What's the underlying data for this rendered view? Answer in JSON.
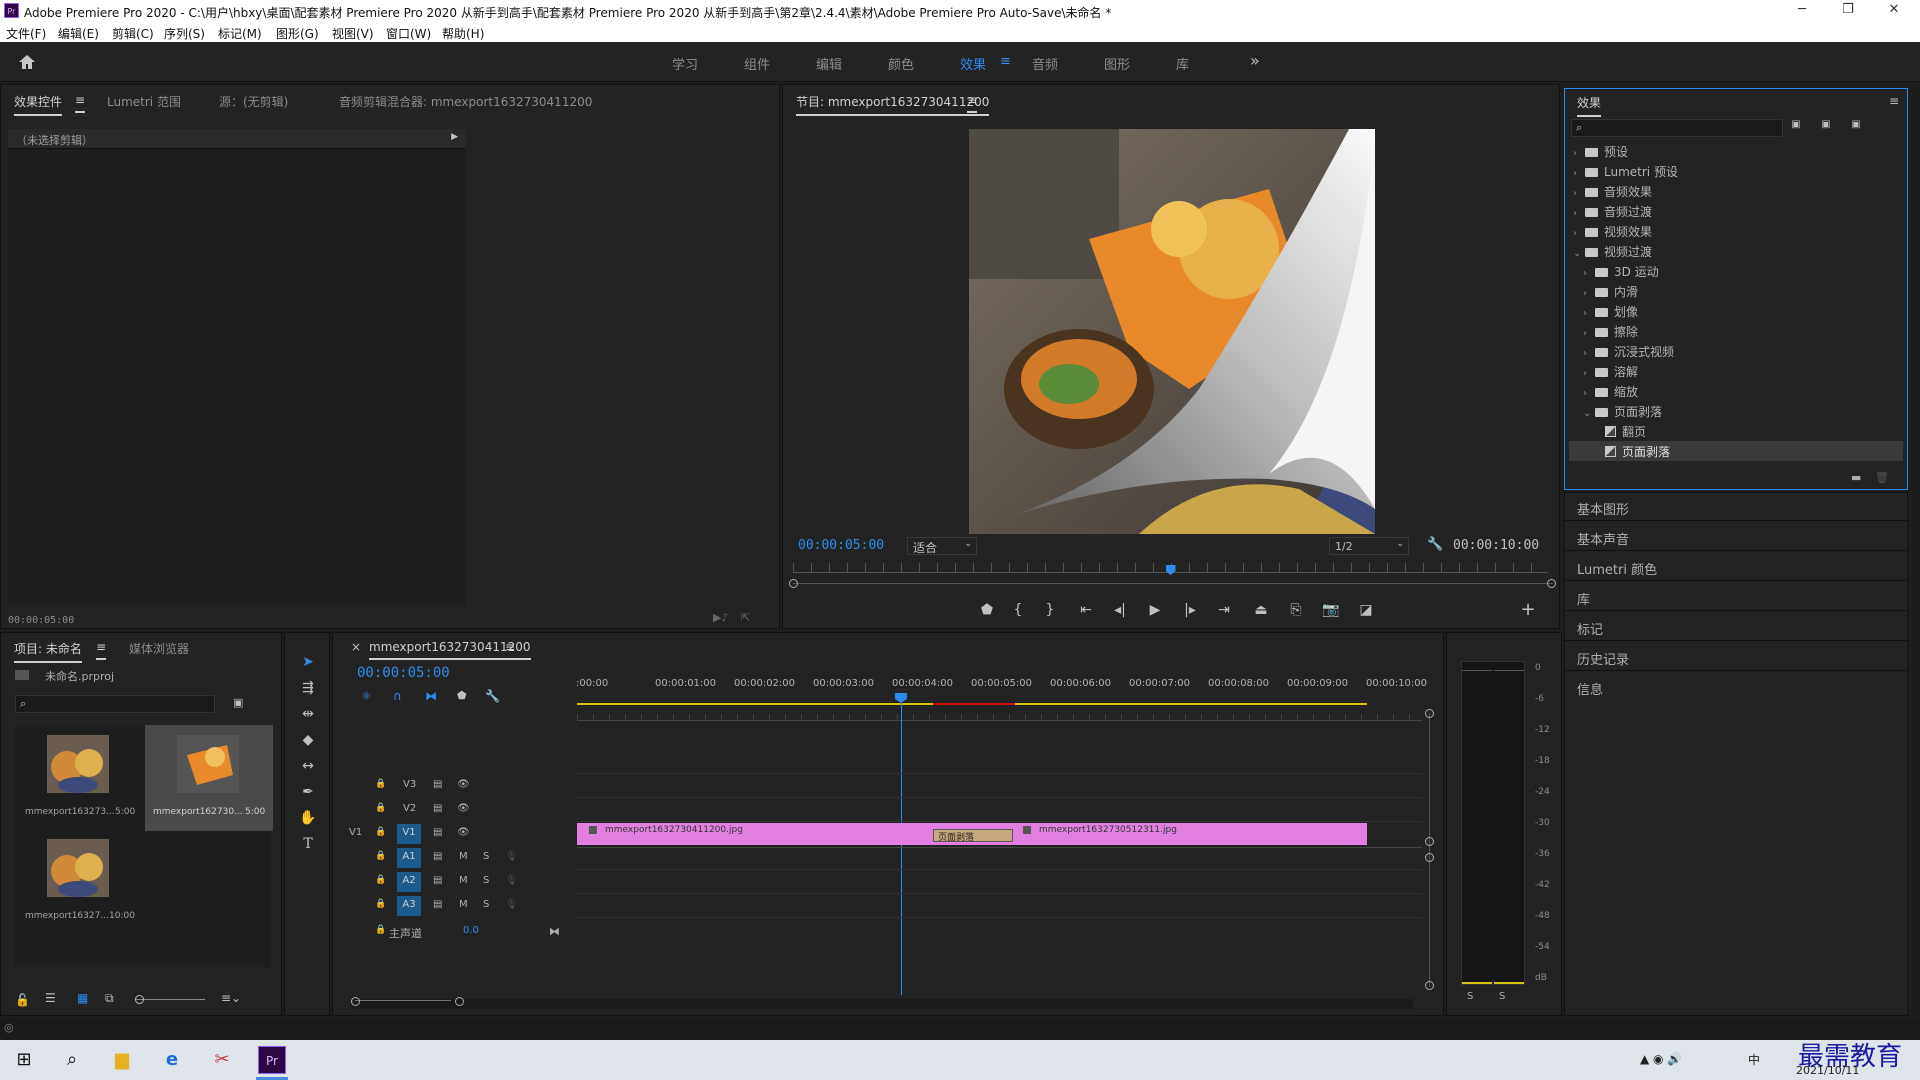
{
  "window": {
    "title": "Adobe Premiere Pro 2020 - C:\\用户\\hbxy\\桌面\\配套素材 Premiere Pro 2020 从新手到高手\\配套素材 Premiere Pro 2020 从新手到高手\\第2章\\2.4.4\\素材\\Adobe Premiere Pro Auto-Save\\未命名 *",
    "logo": "Pr",
    "minimize": "─",
    "maximize": "❐",
    "close": "✕"
  },
  "menu": [
    "文件(F)",
    "编辑(E)",
    "剪辑(C)",
    "序列(S)",
    "标记(M)",
    "图形(G)",
    "视图(V)",
    "窗口(W)",
    "帮助(H)"
  ],
  "workspaces": {
    "items": [
      "学习",
      "组件",
      "编辑",
      "颜色",
      "效果",
      "音频",
      "图形",
      "库"
    ],
    "active": "效果",
    "active_menu": "≡",
    "more": "»"
  },
  "source_panel": {
    "tabs": [
      "效果控件",
      "Lumetri 范围",
      "源：(无剪辑)",
      "音频剪辑混合器: mmexport1632730411200"
    ],
    "menu_glyph": "≡",
    "no_clip": "（未选择剪辑）",
    "timecode": "00:00:05:00"
  },
  "program_monitor": {
    "title": "节目: mmexport1632730411200",
    "menu_glyph": "≡",
    "timecode_current": "00:00:05:00",
    "fit": "适合",
    "resolution": "1/2",
    "timecode_total": "00:00:10:00",
    "playhead_fraction": 0.5,
    "video_colors": {
      "plate": "#e88a2a",
      "food": "#e8b04a",
      "bg": "#6e6459",
      "curl_light": "#f4f4f4",
      "curl_dark": "#6a6a6a"
    }
  },
  "effects_panel": {
    "title": "效果",
    "menu_glyph": "≡",
    "search_placeholder": "",
    "tree": [
      {
        "label": "预设",
        "level": 0,
        "expanded": false,
        "kind": "folder-star"
      },
      {
        "label": "Lumetri 预设",
        "level": 0,
        "expanded": false,
        "kind": "folder-star"
      },
      {
        "label": "音频效果",
        "level": 0,
        "expanded": false,
        "kind": "folder"
      },
      {
        "label": "音频过渡",
        "level": 0,
        "expanded": false,
        "kind": "folder"
      },
      {
        "label": "视频效果",
        "level": 0,
        "expanded": false,
        "kind": "folder"
      },
      {
        "label": "视频过渡",
        "level": 0,
        "expanded": true,
        "kind": "folder"
      },
      {
        "label": "3D 运动",
        "level": 1,
        "expanded": false,
        "kind": "folder"
      },
      {
        "label": "内滑",
        "level": 1,
        "expanded": false,
        "kind": "folder"
      },
      {
        "label": "划像",
        "level": 1,
        "expanded": false,
        "kind": "folder"
      },
      {
        "label": "擦除",
        "level": 1,
        "expanded": false,
        "kind": "folder"
      },
      {
        "label": "沉浸式视频",
        "level": 1,
        "expanded": false,
        "kind": "folder"
      },
      {
        "label": "溶解",
        "level": 1,
        "expanded": false,
        "kind": "folder"
      },
      {
        "label": "缩放",
        "level": 1,
        "expanded": false,
        "kind": "folder"
      },
      {
        "label": "页面剥落",
        "level": 1,
        "expanded": true,
        "kind": "folder"
      },
      {
        "label": "翻页",
        "level": 2,
        "kind": "effect"
      },
      {
        "label": "页面剥落",
        "level": 2,
        "kind": "effect",
        "selected": true
      }
    ]
  },
  "side_panels": [
    "基本图形",
    "基本声音",
    "Lumetri 颜色",
    "库",
    "标记",
    "历史记录",
    "信息"
  ],
  "project_panel": {
    "tabs": [
      "项目: 未命名",
      "媒体浏览器"
    ],
    "menu_glyph": "≡",
    "project_file": "未命名.prproj",
    "items": [
      {
        "name": "mmexport163273...",
        "duration": "5:00"
      },
      {
        "name": "mmexport162730...",
        "duration": "5:00",
        "selected": true
      },
      {
        "name": "mmexport16327...",
        "duration": "10:00"
      }
    ]
  },
  "timeline": {
    "tab": "mmexport1632730411200",
    "close_glyph": "×",
    "menu_glyph": "≡",
    "timecode": "00:00:05:00",
    "ruler": [
      ":00:00",
      "00:00:01:00",
      "00:00:02:00",
      "00:00:03:00",
      "00:00:04:00",
      "00:00:05:00",
      "00:00:06:00",
      "00:00:07:00",
      "00:00:08:00",
      "00:00:09:00",
      "00:00:10:00"
    ],
    "video_tracks": [
      "V3",
      "V2",
      "V1"
    ],
    "audio_tracks": [
      "A1",
      "A2",
      "A3"
    ],
    "source_patch": "V1",
    "mute": "M",
    "solo": "S",
    "master_label": "主声道",
    "master_value": "0.0",
    "clip1": "mmexport1632730411200.jpg",
    "clip2": "mmexport1632730512311.jpg",
    "transition": "页面剥落",
    "playhead_fraction": 0.5,
    "clip_color": "#e27fe0"
  },
  "audio_meter": {
    "scale": [
      "0",
      "-6",
      "-12",
      "-18",
      "-24",
      "-30",
      "-36",
      "-42",
      "-48",
      "-54",
      "dB"
    ],
    "solo_left": "S",
    "solo_right": "S"
  },
  "taskbar": {
    "date": "2021/10/11",
    "ime": "中",
    "watermark": "最需教育"
  }
}
